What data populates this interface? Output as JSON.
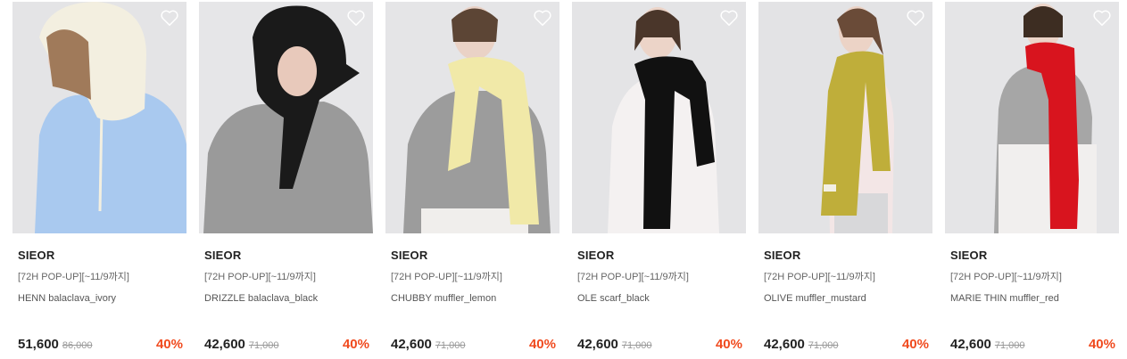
{
  "colors": {
    "discount": "#f04a1e",
    "price": "#222222",
    "original_price": "#999999",
    "image_bg": "#e6e6e8"
  },
  "products": [
    {
      "brand": "SIEOR",
      "tag": "[72H POP-UP][~11/9까지]",
      "name": "HENN balaclava_ivory",
      "price": "51,600",
      "original_price": "86,000",
      "discount": "40%",
      "wish_icon": "heart-outline-icon",
      "accent_color": "#f3efe0",
      "top_color": "#a9c9ef"
    },
    {
      "brand": "SIEOR",
      "tag": "[72H POP-UP][~11/9까지]",
      "name": "DRIZZLE balaclava_black",
      "price": "42,600",
      "original_price": "71,000",
      "discount": "40%",
      "wish_icon": "heart-outline-icon",
      "accent_color": "#1a1a1a",
      "top_color": "#9a9a9a"
    },
    {
      "brand": "SIEOR",
      "tag": "[72H POP-UP][~11/9까지]",
      "name": "CHUBBY muffler_lemon",
      "price": "42,600",
      "original_price": "71,000",
      "discount": "40%",
      "wish_icon": "heart-outline-icon",
      "accent_color": "#f1e9a8",
      "top_color": "#9c9c9c"
    },
    {
      "brand": "SIEOR",
      "tag": "[72H POP-UP][~11/9까지]",
      "name": "OLE scarf_black",
      "price": "42,600",
      "original_price": "71,000",
      "discount": "40%",
      "wish_icon": "heart-outline-icon",
      "accent_color": "#111111",
      "top_color": "#f4f1f1"
    },
    {
      "brand": "SIEOR",
      "tag": "[72H POP-UP][~11/9까지]",
      "name": "OLIVE muffler_mustard",
      "price": "42,600",
      "original_price": "71,000",
      "discount": "40%",
      "wish_icon": "heart-outline-icon",
      "accent_color": "#bfae3a",
      "top_color": "#f3e6e6"
    },
    {
      "brand": "SIEOR",
      "tag": "[72H POP-UP][~11/9까지]",
      "name": "MARIE THIN muffler_red",
      "price": "42,600",
      "original_price": "71,000",
      "discount": "40%",
      "wish_icon": "heart-outline-icon",
      "accent_color": "#d8141e",
      "top_color": "#a6a6a6"
    }
  ]
}
